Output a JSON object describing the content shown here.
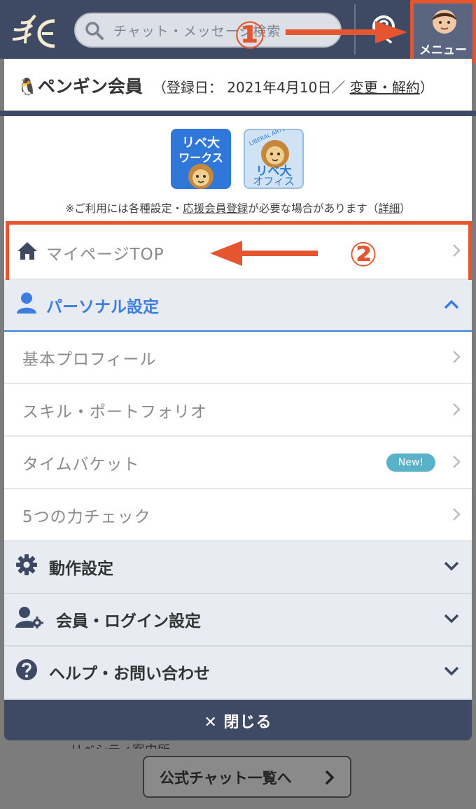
{
  "header": {
    "search_placeholder": "チャット・メッセージ検索",
    "menu_label": "メニュー"
  },
  "member": {
    "icon_glyph": "🐧",
    "name": "ペンギン会員",
    "date_prefix": "（登録日： 2021年4月10日／ ",
    "change_link": "変更・解約",
    "date_suffix": "）"
  },
  "apps": {
    "works": [
      "リベ大",
      "ワークス"
    ],
    "office": [
      "リベ大",
      "オフィス"
    ],
    "office_arc": "LIBERAL ARTS"
  },
  "notice": {
    "prefix": "※ご利用には各種設定・",
    "link1": "応援会員登録",
    "middle": "が必要な場合があります（",
    "link2": "詳細",
    "suffix": "）"
  },
  "mypage": {
    "label": "マイページTOP"
  },
  "annotations": {
    "marker1": "①",
    "marker2": "②"
  },
  "personal": {
    "title": "パーソナル設定",
    "items": [
      {
        "label": "基本プロフィール"
      },
      {
        "label": "スキル・ポートフォリオ"
      },
      {
        "label": "タイムバケット",
        "badge": "New!"
      },
      {
        "label": "5つの力チェック"
      }
    ]
  },
  "sections": [
    {
      "label": "動作設定",
      "icon": "gear-icon"
    },
    {
      "label": "会員・ログイン設定",
      "icon": "user-gear-icon"
    },
    {
      "label": "ヘルプ・お問い合わせ",
      "icon": "question-circle-icon"
    }
  ],
  "close_label": "✕ 閉じる",
  "background": {
    "partial_text": "リベシティ案内所",
    "footer_button": "公式チャット一覧へ"
  },
  "colors": {
    "header": "#3e4a63",
    "accent_blue": "#3b7de0",
    "highlight": "#e5552f",
    "badge": "#5ab2c8"
  }
}
